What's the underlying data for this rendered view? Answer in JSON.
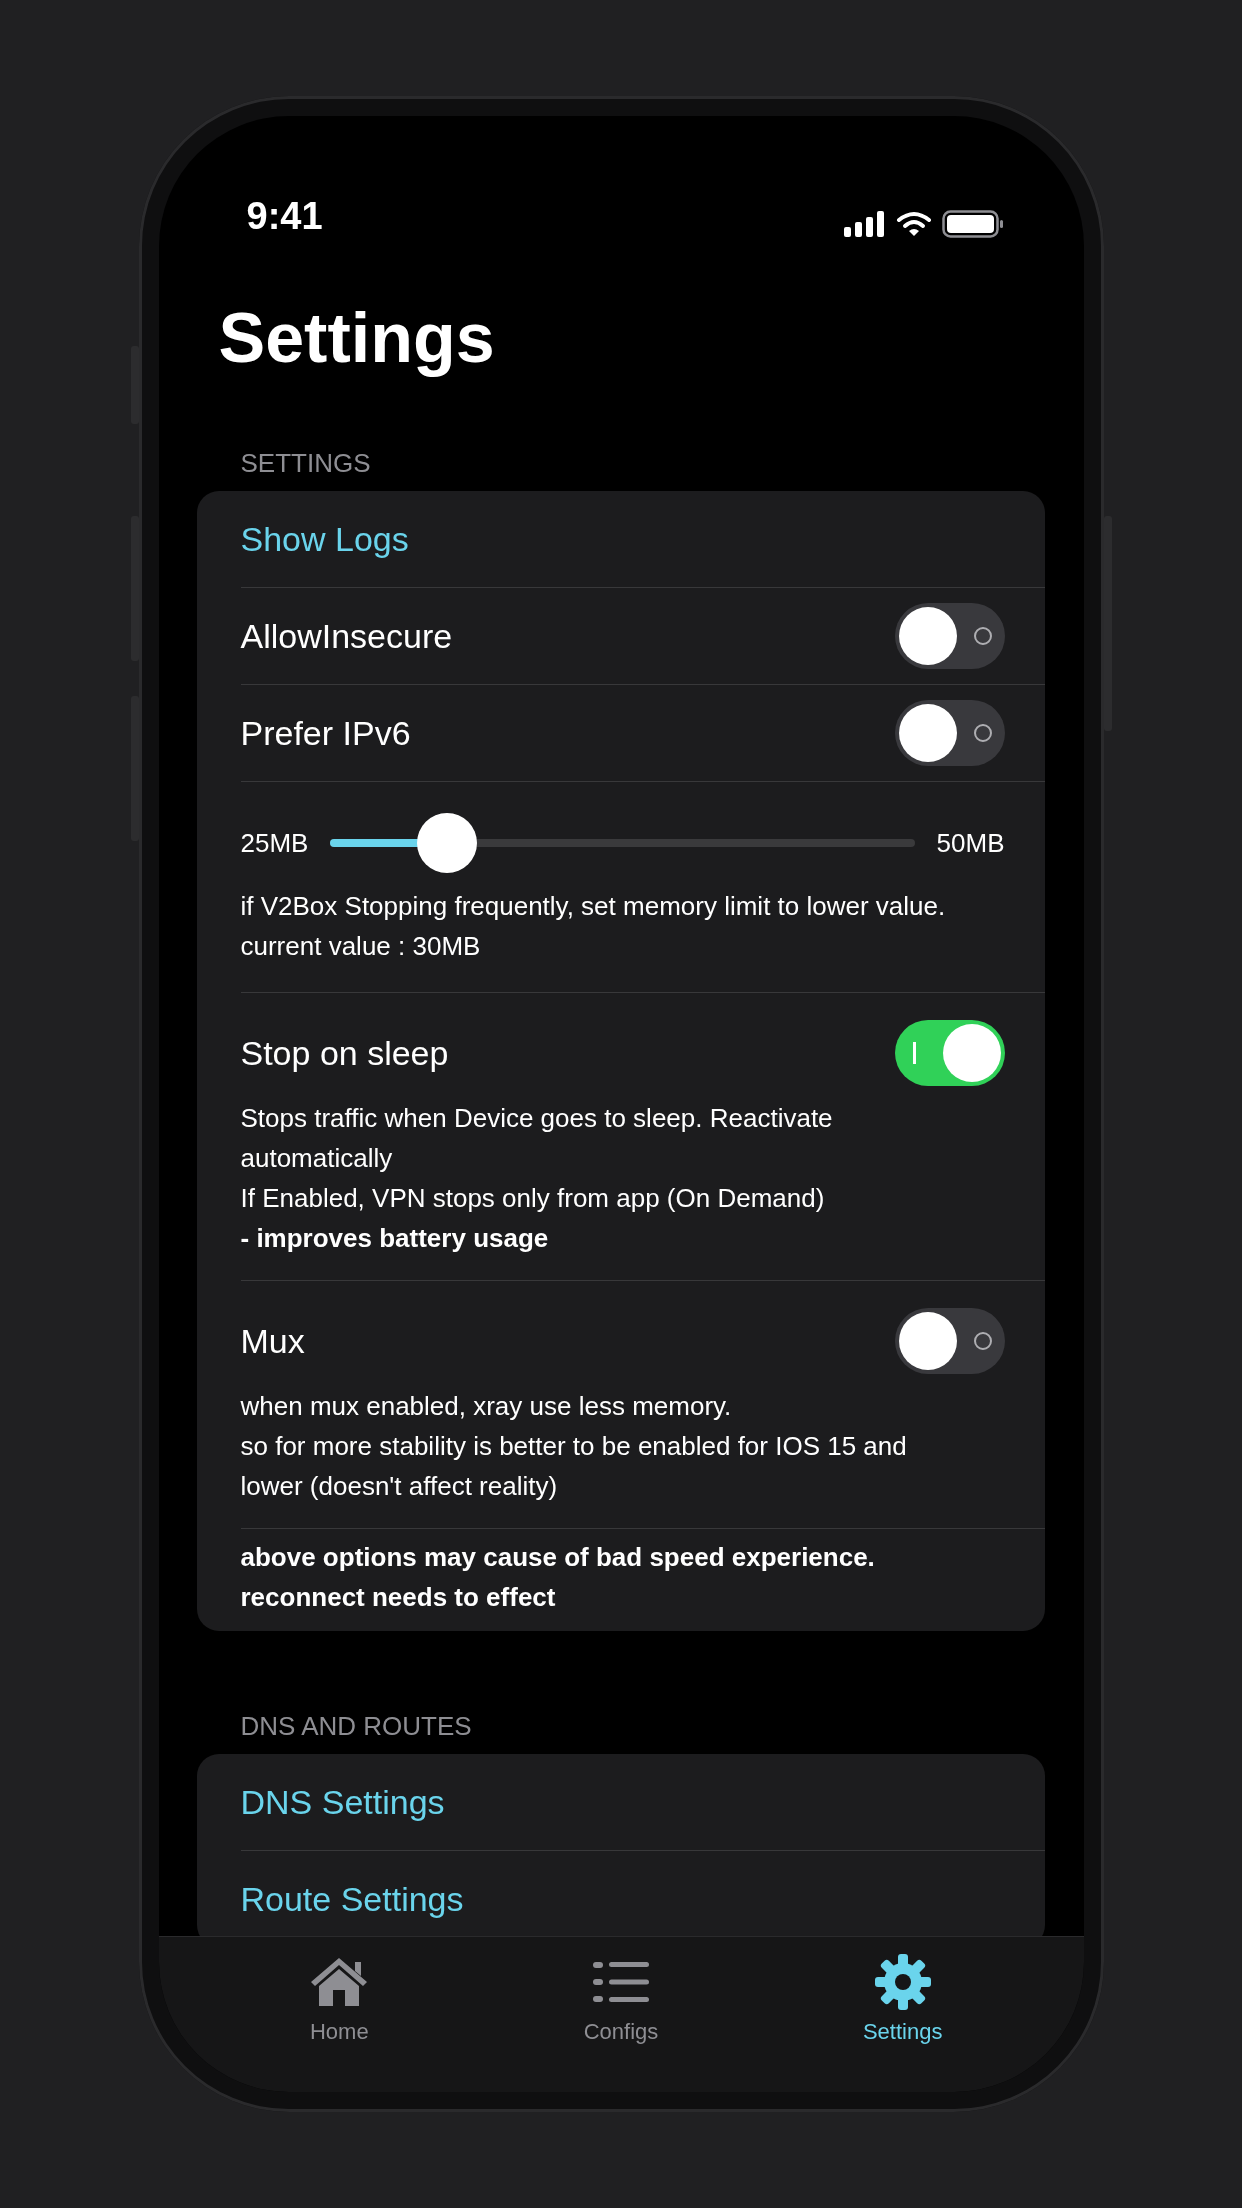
{
  "status_bar": {
    "time": "9:41"
  },
  "title": "Settings",
  "sections": [
    {
      "header": "SETTINGS",
      "rows": [
        {
          "kind": "link",
          "label": "Show Logs"
        },
        {
          "kind": "toggle",
          "label": "AllowInsecure",
          "on": false
        },
        {
          "kind": "toggle",
          "label": "Prefer IPv6",
          "on": false
        },
        {
          "kind": "slider",
          "min_label": "25MB",
          "max_label": "50MB",
          "level": 0.2,
          "lines": [
            {
              "text": "if V2Box Stopping frequently, set memory limit to lower value.",
              "bold": false
            },
            {
              "text": "current value : 30MB",
              "bold": false
            }
          ]
        },
        {
          "kind": "toggle",
          "label": "Stop on sleep",
          "on": true,
          "lines": [
            {
              "text": "Stops traffic when Device goes to sleep. Reactivate automatically",
              "bold": false
            },
            {
              "text": "If Enabled, VPN stops only from app (On Demand)",
              "bold": false
            },
            {
              "text": "- improves battery usage",
              "bold": true
            }
          ]
        },
        {
          "kind": "toggle",
          "label": "Mux",
          "on": false,
          "lines": [
            {
              "text": "when mux enabled, xray use less memory.",
              "bold": false
            },
            {
              "text": "so for more stability is better to be enabled for IOS 15 and lower (doesn't affect reality)",
              "bold": false
            }
          ]
        },
        {
          "kind": "note",
          "lines": [
            {
              "text": "above options may cause of bad speed experience.",
              "bold": true
            },
            {
              "text": "reconnect needs to effect",
              "bold": true
            }
          ]
        }
      ]
    },
    {
      "header": "DNS AND ROUTES",
      "rows": [
        {
          "kind": "link",
          "label": "DNS Settings"
        },
        {
          "kind": "link",
          "label": "Route Settings"
        }
      ]
    }
  ],
  "tabs": [
    {
      "kind": "home",
      "label": "Home",
      "selected": false
    },
    {
      "kind": "list",
      "label": "Configs",
      "selected": false
    },
    {
      "kind": "gear",
      "label": "Settings",
      "selected": true
    }
  ]
}
